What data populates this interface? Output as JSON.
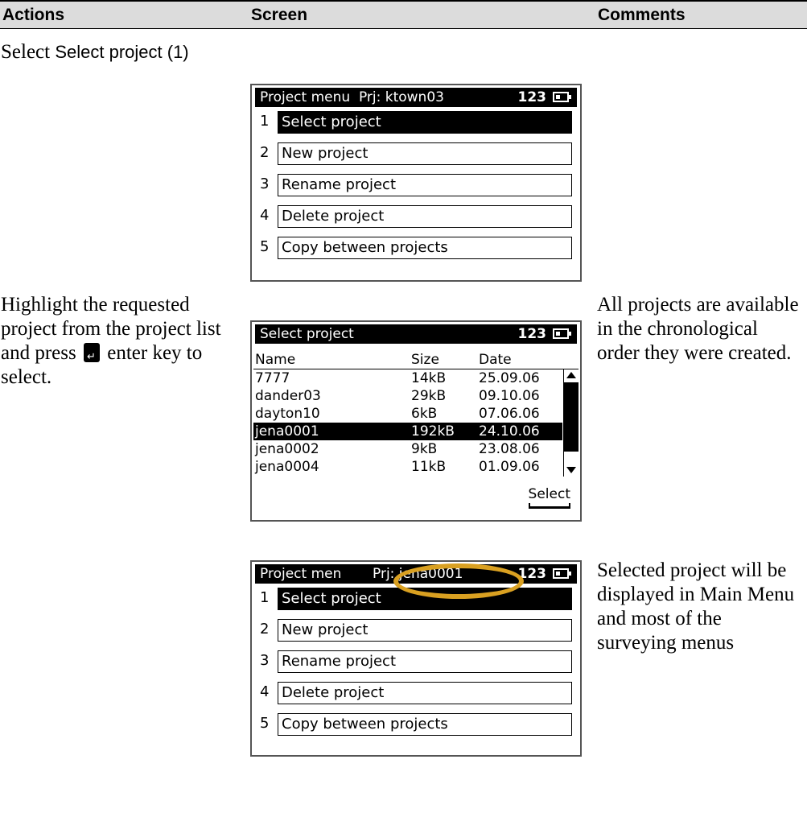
{
  "header": {
    "actions": "Actions",
    "screen": "Screen",
    "comments": "Comments"
  },
  "rows": [
    {
      "action_prefix": "Select ",
      "action_ui": "Select project (1)",
      "comment": "",
      "screen": {
        "title": "Project menu  Prj: ktown03",
        "code": "123",
        "items": [
          {
            "num": "1",
            "label": "Select project"
          },
          {
            "num": "2",
            "label": "New project"
          },
          {
            "num": "3",
            "label": "Rename project"
          },
          {
            "num": "4",
            "label": "Delete project"
          },
          {
            "num": "5",
            "label": "Copy between projects"
          }
        ],
        "selected_index": 0
      }
    },
    {
      "action_part1": "Highlight the requested project from the project list and press",
      "action_part2": "enter key to select.",
      "comment": "All projects are available in the chronological order they were created.",
      "screen": {
        "title": "Select project",
        "code": "123",
        "columns": [
          "Name",
          "Size",
          "Date"
        ],
        "rows": [
          [
            "7777",
            "14kB",
            "25.09.06"
          ],
          [
            "dander03",
            "29kB",
            "09.10.06"
          ],
          [
            "dayton10",
            "6kB",
            "07.06.06"
          ],
          [
            "jena0001",
            "192kB",
            "24.10.06"
          ],
          [
            "jena0002",
            "9kB",
            "23.08.06"
          ],
          [
            "jena0004",
            "11kB",
            "01.09.06"
          ]
        ],
        "highlighted_row": 3,
        "softkey": "Select"
      }
    },
    {
      "action": "",
      "comment": "Selected project will be displayed in Main Menu and most of the surveying menus",
      "screen": {
        "title_left": "Project men",
        "title_prj": "Prj: jena0001",
        "code": "123",
        "items": [
          {
            "num": "1",
            "label": "Select project"
          },
          {
            "num": "2",
            "label": "New project"
          },
          {
            "num": "3",
            "label": "Rename project"
          },
          {
            "num": "4",
            "label": "Delete project"
          },
          {
            "num": "5",
            "label": "Copy between projects"
          }
        ],
        "selected_index": 0,
        "highlight_color": "#d9a021"
      }
    }
  ]
}
